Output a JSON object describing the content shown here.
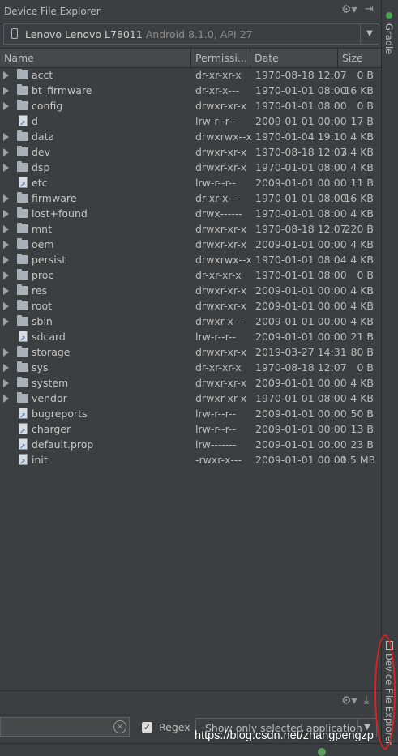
{
  "title": "Device File Explorer",
  "device": {
    "name": "Lenovo Lenovo L78011",
    "version": "Android 8.1.0, API 27"
  },
  "columns": {
    "name": "Name",
    "permissions": "Permissi...",
    "date": "Date",
    "size": "Size"
  },
  "rows": [
    {
      "type": "folder",
      "name": "acct",
      "perm": "dr-xr-xr-x",
      "date": "1970-08-18 12:07",
      "size": "0 B"
    },
    {
      "type": "folder",
      "name": "bt_firmware",
      "perm": "dr-xr-x---",
      "date": "1970-01-01 08:00",
      "size": "16 KB"
    },
    {
      "type": "folder",
      "name": "config",
      "perm": "drwxr-xr-x",
      "date": "1970-01-01 08:00",
      "size": "0 B"
    },
    {
      "type": "link",
      "name": "d",
      "perm": "lrw-r--r--",
      "date": "2009-01-01 00:00",
      "size": "17 B"
    },
    {
      "type": "folder",
      "name": "data",
      "perm": "drwxrwx--x",
      "date": "1970-01-04 19:10",
      "size": "4 KB"
    },
    {
      "type": "folder",
      "name": "dev",
      "perm": "drwxr-xr-x",
      "date": "1970-08-18 12:07",
      "size": "3.4 KB"
    },
    {
      "type": "folder",
      "name": "dsp",
      "perm": "drwxr-xr-x",
      "date": "1970-01-01 08:00",
      "size": "4 KB"
    },
    {
      "type": "link",
      "name": "etc",
      "perm": "lrw-r--r--",
      "date": "2009-01-01 00:00",
      "size": "11 B"
    },
    {
      "type": "folder",
      "name": "firmware",
      "perm": "dr-xr-x---",
      "date": "1970-01-01 08:00",
      "size": "16 KB"
    },
    {
      "type": "folder",
      "name": "lost+found",
      "perm": "drwx------",
      "date": "1970-01-01 08:00",
      "size": "4 KB"
    },
    {
      "type": "folder",
      "name": "mnt",
      "perm": "drwxr-xr-x",
      "date": "1970-08-18 12:07",
      "size": "220 B"
    },
    {
      "type": "folder",
      "name": "oem",
      "perm": "drwxr-xr-x",
      "date": "2009-01-01 00:00",
      "size": "4 KB"
    },
    {
      "type": "folder",
      "name": "persist",
      "perm": "drwxrwx--x",
      "date": "1970-01-01 08:04",
      "size": "4 KB"
    },
    {
      "type": "folder",
      "name": "proc",
      "perm": "dr-xr-xr-x",
      "date": "1970-01-01 08:00",
      "size": "0 B"
    },
    {
      "type": "folder",
      "name": "res",
      "perm": "drwxr-xr-x",
      "date": "2009-01-01 00:00",
      "size": "4 KB"
    },
    {
      "type": "folder",
      "name": "root",
      "perm": "drwxr-xr-x",
      "date": "2009-01-01 00:00",
      "size": "4 KB"
    },
    {
      "type": "folder",
      "name": "sbin",
      "perm": "drwxr-x---",
      "date": "2009-01-01 00:00",
      "size": "4 KB"
    },
    {
      "type": "link",
      "name": "sdcard",
      "perm": "lrw-r--r--",
      "date": "2009-01-01 00:00",
      "size": "21 B"
    },
    {
      "type": "folder",
      "name": "storage",
      "perm": "drwxr-xr-x",
      "date": "2019-03-27 14:31",
      "size": "80 B"
    },
    {
      "type": "folder",
      "name": "sys",
      "perm": "dr-xr-xr-x",
      "date": "1970-08-18 12:07",
      "size": "0 B"
    },
    {
      "type": "folder",
      "name": "system",
      "perm": "drwxr-xr-x",
      "date": "2009-01-01 00:00",
      "size": "4 KB"
    },
    {
      "type": "folder",
      "name": "vendor",
      "perm": "drwxr-xr-x",
      "date": "1970-01-01 08:00",
      "size": "4 KB"
    },
    {
      "type": "link",
      "name": "bugreports",
      "perm": "lrw-r--r--",
      "date": "2009-01-01 00:00",
      "size": "50 B"
    },
    {
      "type": "link",
      "name": "charger",
      "perm": "lrw-r--r--",
      "date": "2009-01-01 00:00",
      "size": "13 B"
    },
    {
      "type": "link",
      "name": "default.prop",
      "perm": "lrw-------",
      "date": "2009-01-01 00:00",
      "size": "23 B"
    },
    {
      "type": "link",
      "name": "init",
      "perm": "-rwxr-x---",
      "date": "2009-01-01 00:00",
      "size": "1.5 MB"
    }
  ],
  "logcat": {
    "regex_label": "Regex",
    "filter_value": "Show only selected application",
    "clear_glyph": "×"
  },
  "side_tabs": {
    "gradle": "Gradle",
    "device_file_explorer": "Device File Explorer"
  },
  "watermark": "https://blog.csdn.net/zhangpengzp",
  "icons": {
    "settings": "⚙▾",
    "hide": "⇥",
    "download": "⤓",
    "dropdown": "▼",
    "check": "✓"
  }
}
